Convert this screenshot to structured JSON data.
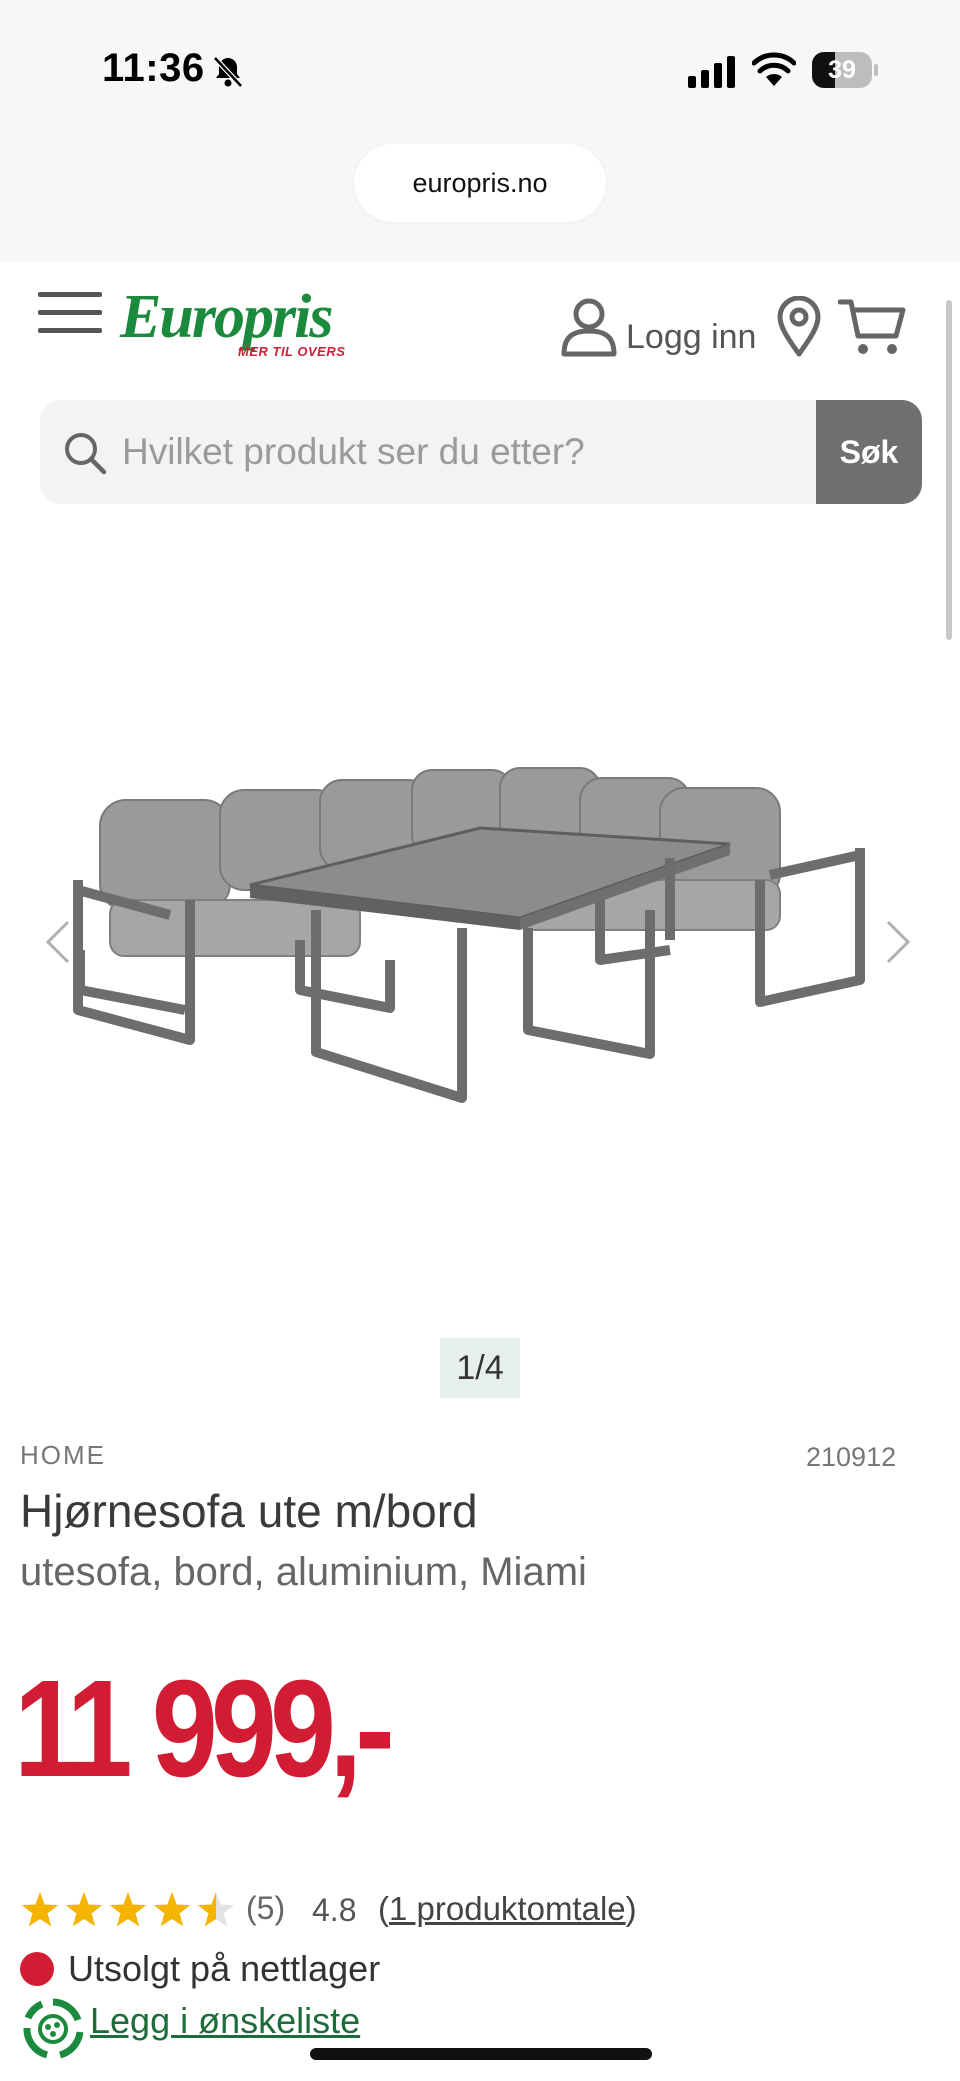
{
  "status_bar": {
    "time": "11:36",
    "battery_level": 39,
    "battery_label": "39",
    "icons": [
      "bell-slash-icon",
      "signal-icon",
      "wifi-icon",
      "battery-icon"
    ]
  },
  "browser": {
    "url": "europris.no"
  },
  "header": {
    "logo_text": "Europris",
    "logo_tagline": "MER TIL OVERS",
    "login_label": "Logg inn",
    "brand_green": "#1c8a3c",
    "brand_red": "#d21c34"
  },
  "search": {
    "placeholder": "Hvilket produkt ser du etter?",
    "button_label": "Søk"
  },
  "gallery": {
    "counter": "1/4",
    "image_alt": "product-photo"
  },
  "product": {
    "brand": "HOME",
    "sku": "210912",
    "title": "Hjørnesofa ute m/bord",
    "subtitle": "utesofa, bord, aluminium, Miami",
    "price": "11 999,-"
  },
  "rating": {
    "stars": 4.5,
    "count_label": "(5)",
    "score": "4.8",
    "open_paren": "(",
    "review_link": "1 produktomtale",
    "close_paren": ")"
  },
  "stock": {
    "status": "Utsolgt på nettlager",
    "status_color": "#d21c34"
  },
  "wishlist": {
    "label": "Legg i ønskeliste"
  }
}
